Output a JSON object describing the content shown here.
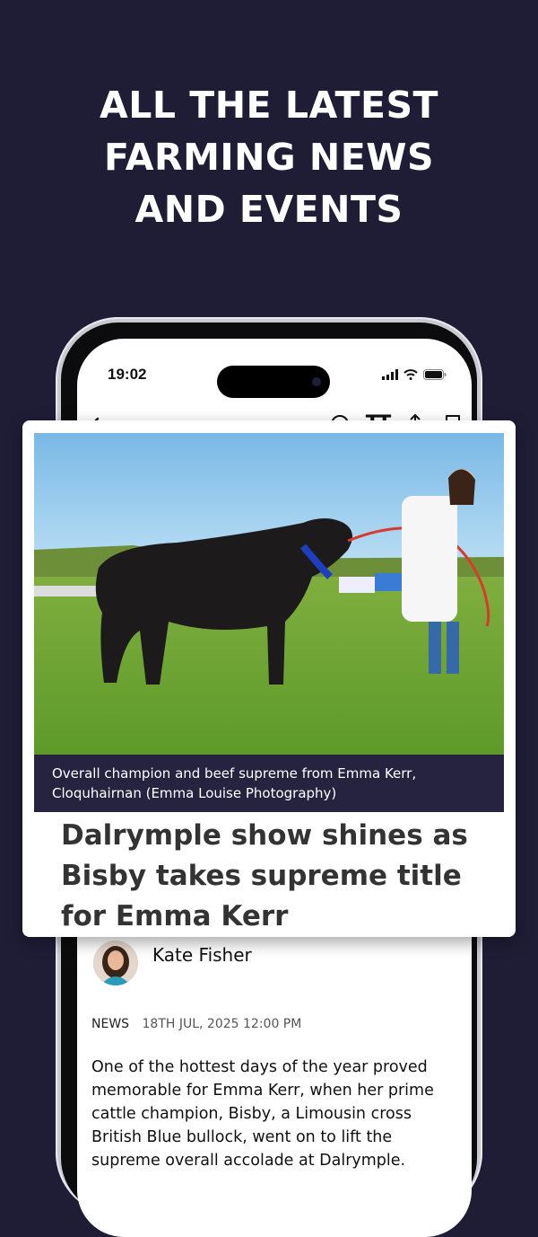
{
  "promo": {
    "headline_lines": [
      "ALL THE LATEST",
      "FARMING NEWS",
      "AND EVENTS"
    ]
  },
  "status_bar": {
    "time": "19:02"
  },
  "toolbar": {
    "back_icon": "arrow-left-icon",
    "listen_icon": "headphones-icon",
    "text_size_label": "TT",
    "share_icon": "share-icon",
    "bookmark_icon": "bookmark-icon"
  },
  "article": {
    "image_caption": "Overall champion and beef supreme from Emma Kerr, Cloquhairnan (Emma Louise Photography)",
    "title": "Dalrymple show shines as Bisby takes supreme title for Emma Kerr",
    "author": "Kate Fisher",
    "category": "NEWS",
    "date": "18TH JUL, 2025 12:00 PM",
    "body": "One of the hottest days of the year proved memorable for Emma Kerr, when her prime cattle champion, Bisby, a Limousin cross British Blue bullock, went on to lift the supreme overall accolade at Dalrymple."
  },
  "colors": {
    "background": "#1f1d36",
    "caption_bg": "#25233f",
    "accent_text": "#333333"
  }
}
